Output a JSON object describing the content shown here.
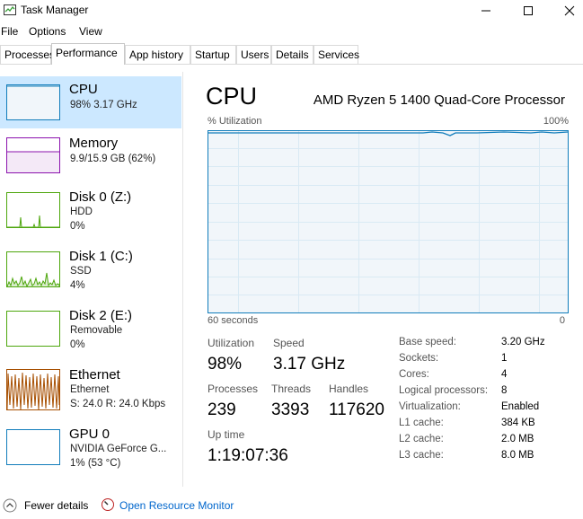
{
  "window": {
    "title": "Task Manager"
  },
  "menu": [
    "File",
    "Options",
    "View"
  ],
  "tabs": [
    "Processes",
    "Performance",
    "App history",
    "Startup",
    "Users",
    "Details",
    "Services"
  ],
  "active_tab": "Performance",
  "sidebar": [
    {
      "name": "CPU",
      "sub1": "98% 3.17 GHz",
      "sub2": "",
      "color": "#117dbb"
    },
    {
      "name": "Memory",
      "sub1": "9.9/15.9 GB (62%)",
      "sub2": "",
      "color": "#8b12ae"
    },
    {
      "name": "Disk 0 (Z:)",
      "sub1": "HDD",
      "sub2": "0%",
      "color": "#4da60c"
    },
    {
      "name": "Disk 1 (C:)",
      "sub1": "SSD",
      "sub2": "4%",
      "color": "#4da60c"
    },
    {
      "name": "Disk 2 (E:)",
      "sub1": "Removable",
      "sub2": "0%",
      "color": "#4da60c"
    },
    {
      "name": "Ethernet",
      "sub1": "Ethernet",
      "sub2": "S: 24.0  R: 24.0 Kbps",
      "color": "#a74f01"
    },
    {
      "name": "GPU 0",
      "sub1": "NVIDIA GeForce G...",
      "sub2": "1% (53 °C)",
      "color": "#117dbb"
    }
  ],
  "main": {
    "title": "CPU",
    "model": "AMD Ryzen 5 1400 Quad-Core Processor",
    "util_label": "% Utilization",
    "util_max": "100%",
    "time_left": "60 seconds",
    "time_right": "0",
    "stats": {
      "utilization_label": "Utilization",
      "utilization": "98%",
      "speed_label": "Speed",
      "speed": "3.17 GHz",
      "processes_label": "Processes",
      "processes": "239",
      "threads_label": "Threads",
      "threads": "3393",
      "handles_label": "Handles",
      "handles": "117620",
      "uptime_label": "Up time",
      "uptime": "1:19:07:36"
    },
    "specs": [
      {
        "label": "Base speed:",
        "value": "3.20 GHz"
      },
      {
        "label": "Sockets:",
        "value": "1"
      },
      {
        "label": "Cores:",
        "value": "4"
      },
      {
        "label": "Logical processors:",
        "value": "8"
      },
      {
        "label": "Virtualization:",
        "value": "Enabled"
      },
      {
        "label": "L1 cache:",
        "value": "384 KB"
      },
      {
        "label": "L2 cache:",
        "value": "2.0 MB"
      },
      {
        "label": "L3 cache:",
        "value": "8.0 MB"
      }
    ]
  },
  "footer": {
    "fewer_details": "Fewer details",
    "resource_monitor": "Open Resource Monitor"
  },
  "colors": {
    "cpu": "#117dbb",
    "selected_bg": "#cce8ff",
    "link": "#0066cc"
  }
}
